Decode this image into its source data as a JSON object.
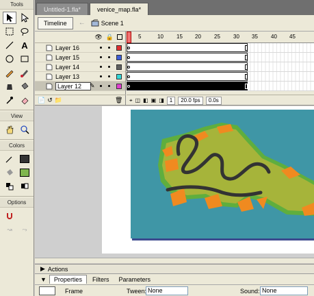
{
  "tools": {
    "header": "Tools",
    "view_header": "View",
    "colors_header": "Colors",
    "options_header": "Options"
  },
  "tabs": [
    "Untitled-1.fla*",
    "venice_map.fla*"
  ],
  "toolbar": {
    "timeline_label": "Timeline",
    "scene_label": "Scene 1"
  },
  "layers": [
    {
      "name": "Layer 16",
      "color": "#e03030"
    },
    {
      "name": "Layer 15",
      "color": "#3f5fd8"
    },
    {
      "name": "Layer 14",
      "color": "#606060"
    },
    {
      "name": "Layer 13",
      "color": "#34d6d6"
    },
    {
      "name": "Layer 12",
      "color": "#e040d0"
    }
  ],
  "ruler": [
    "1",
    "5",
    "10",
    "15",
    "20",
    "25",
    "30",
    "35",
    "40",
    "45"
  ],
  "status": {
    "frame": "1",
    "fps": "20.0 fps",
    "time": "0.0s"
  },
  "panels": {
    "actions": "Actions",
    "properties_tabs": [
      "Properties",
      "Filters",
      "Parameters"
    ]
  },
  "properties": {
    "label": "Frame",
    "tween_label": "Tween:",
    "tween_value": "None",
    "sound_label": "Sound:",
    "sound_value": "None"
  },
  "colors": {
    "stage_bg": "#3f96a6",
    "land": "#a6b43a",
    "orange": "#f08a20",
    "green_edge": "#5fae3e",
    "canal": "#333333"
  }
}
